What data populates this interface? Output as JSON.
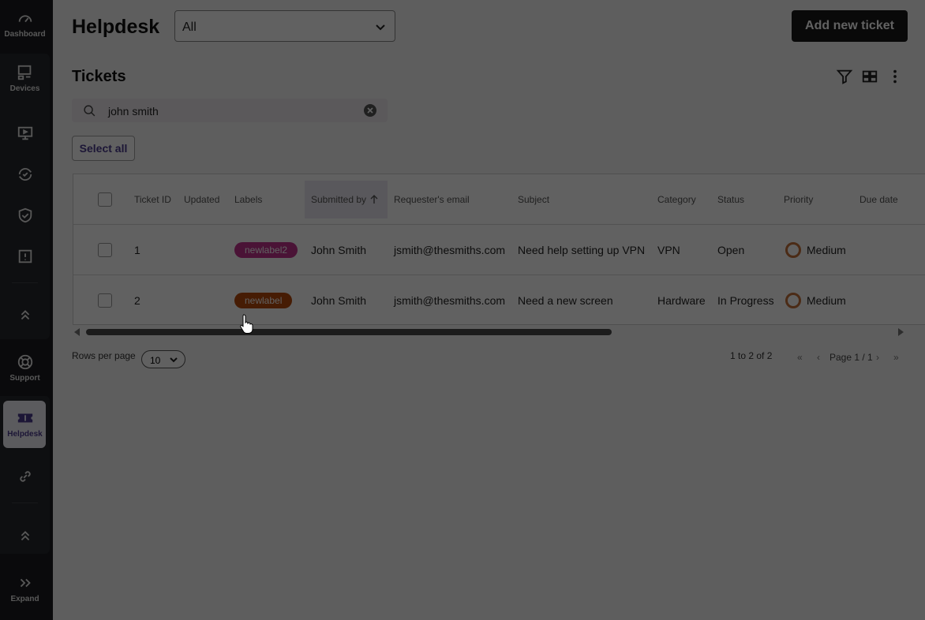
{
  "sidebar": {
    "items": [
      {
        "label": "Dashboard",
        "icon": "speedometer-icon"
      },
      {
        "label": "Devices",
        "icon": "devices-icon"
      },
      {
        "label": "",
        "icon": "monitor-play-icon"
      },
      {
        "label": "",
        "icon": "refresh-icon"
      },
      {
        "label": "",
        "icon": "shield-check-icon"
      },
      {
        "label": "",
        "icon": "alert-icon"
      },
      {
        "label": "",
        "icon": "chevrons-up-icon"
      },
      {
        "label": "Support",
        "icon": "lifebuoy-icon"
      },
      {
        "label": "Helpdesk",
        "icon": "ticket-icon"
      },
      {
        "label": "",
        "icon": "link-icon"
      },
      {
        "label": "",
        "icon": "chevrons-up-icon"
      },
      {
        "label": "Expand",
        "icon": "chevrons-right-icon"
      }
    ]
  },
  "header": {
    "title": "Helpdesk",
    "filter_value": "All",
    "add_button": "Add new ticket"
  },
  "tickets": {
    "title": "Tickets",
    "search_value": "john smith",
    "select_all": "Select all",
    "columns": [
      "Ticket ID",
      "Updated",
      "Labels",
      "Submitted by",
      "Requester's email",
      "Subject",
      "Category",
      "Status",
      "Priority",
      "Due date"
    ],
    "rows": [
      {
        "id": "1",
        "updated": "",
        "label": "newlabel2",
        "label_color": "#c2338f",
        "submitted_by": "John Smith",
        "email": "jsmith@thesmiths.com",
        "subject": "Need help setting up VPN",
        "category": "VPN",
        "status": "Open",
        "priority": "Medium",
        "due": ""
      },
      {
        "id": "2",
        "updated": "",
        "label": "newlabel",
        "label_color": "#b84a0c",
        "submitted_by": "John Smith",
        "email": "jsmith@thesmiths.com",
        "subject": "Need a new screen",
        "category": "Hardware",
        "status": "In Progress",
        "priority": "Medium",
        "due": ""
      }
    ]
  },
  "pagination": {
    "rows_per_page_label": "Rows per page",
    "rows_per_page": "10",
    "range": "1 to 2 of 2",
    "page": "Page 1 / 1"
  },
  "colors": {
    "accent": "#4a3b8f",
    "priority_medium": "#c4713a"
  }
}
